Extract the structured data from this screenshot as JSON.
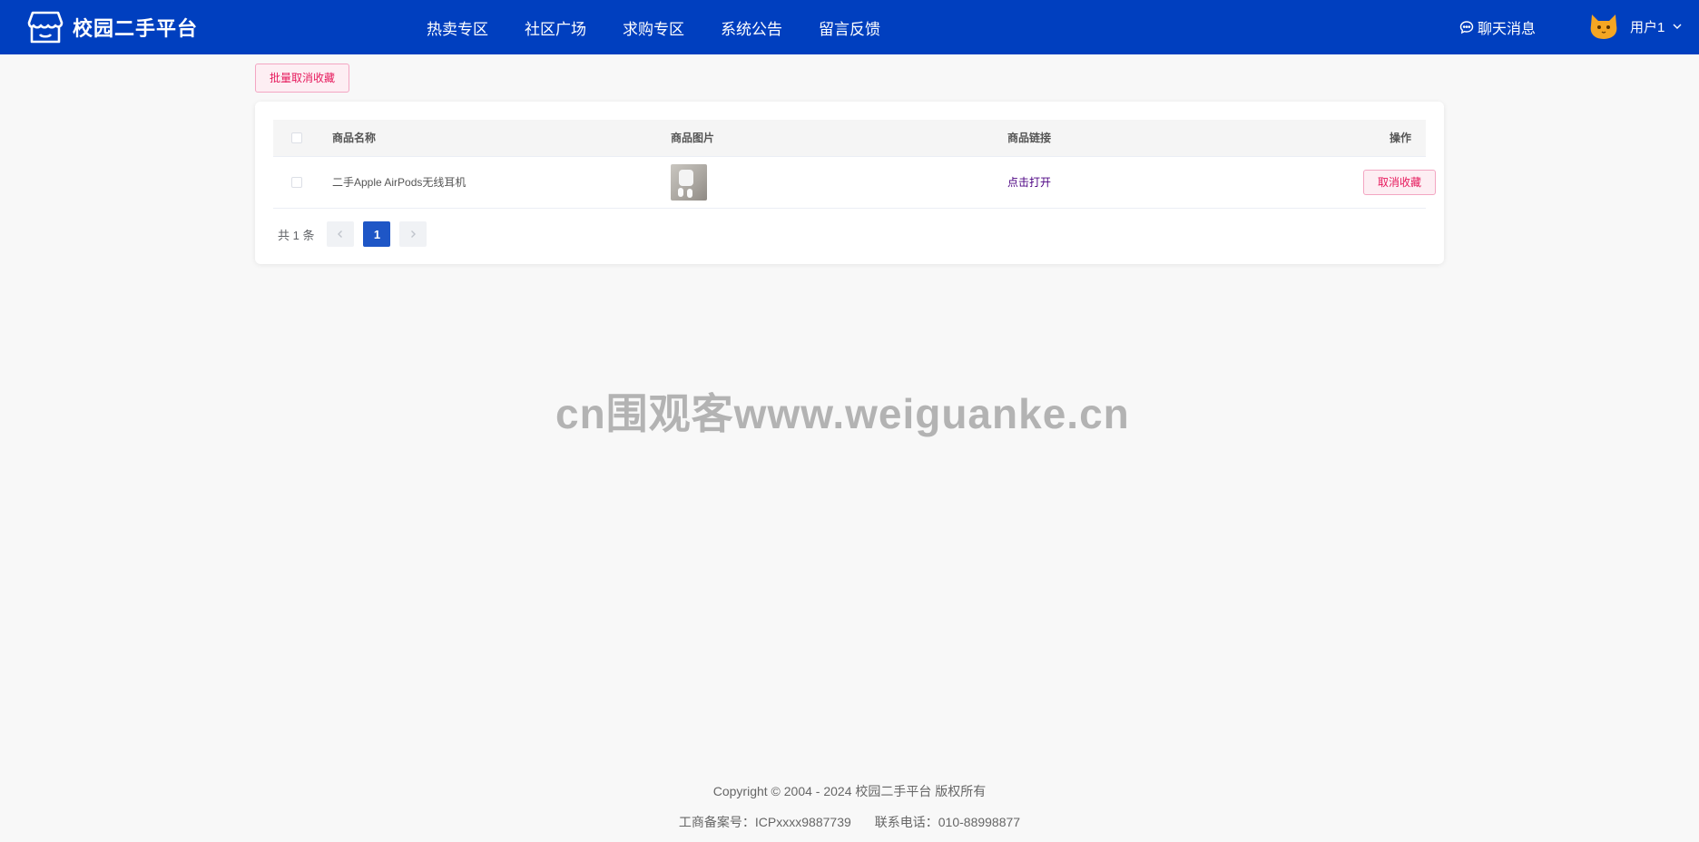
{
  "header": {
    "logo_text": "校园二手平台",
    "nav": [
      "热卖专区",
      "社区广场",
      "求购专区",
      "系统公告",
      "留言反馈"
    ],
    "chat_label": "聊天消息",
    "user_name": "用户1"
  },
  "toolbar": {
    "batch_cancel_label": "批量取消收藏"
  },
  "table": {
    "columns": [
      "商品名称",
      "商品图片",
      "商品链接",
      "操作"
    ],
    "rows": [
      {
        "name": "二手Apple AirPods无线耳机",
        "link_text": "点击打开",
        "action_label": "取消收藏"
      }
    ]
  },
  "pagination": {
    "total_text": "共 1 条",
    "current_page": "1"
  },
  "watermark": "cn围观客www.weiguanke.cn",
  "footer": {
    "copyright": "Copyright © 2004 - 2024 校园二手平台 版权所有",
    "icp": "工商备案号：ICPxxxx9887739",
    "phone": "联系电话：010-88998877"
  },
  "colors": {
    "header_bg": "#003fbf",
    "accent_pink": "#e6195c",
    "page_active": "#1e56c6"
  }
}
